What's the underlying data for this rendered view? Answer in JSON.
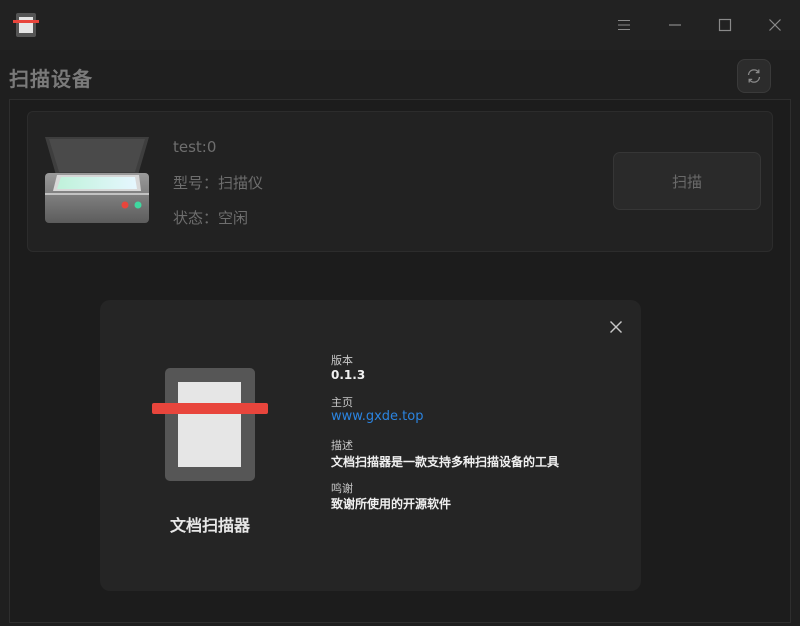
{
  "window": {
    "controls": [
      "menu-icon",
      "minimize-icon",
      "maximize-icon",
      "close-icon"
    ]
  },
  "header": {
    "title": "扫描设备"
  },
  "device": {
    "name": "test:0",
    "model": "型号：扫描仪",
    "status": "状态：空闲",
    "scan_label": "扫描"
  },
  "about": {
    "app_name": "文档扫描器",
    "version_label": "版本",
    "version_value": "0.1.3",
    "homepage_label": "主页",
    "homepage_value": "www.gxde.top",
    "description_label": "描述",
    "description_value": "文档扫描器是一款支持多种扫描设备的工具",
    "thanks_label": "鸣谢",
    "thanks_value": "致谢所使用的开源软件"
  },
  "colors": {
    "accent_red": "#e8453c",
    "link_blue": "#2b84e0",
    "background": "#1f1f1f"
  }
}
